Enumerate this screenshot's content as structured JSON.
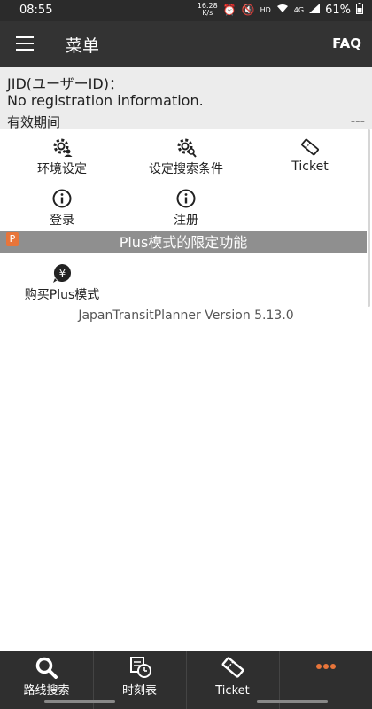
{
  "status_bar": {
    "time": "08:55",
    "speed_value": "16.28",
    "speed_unit": "K/s",
    "network": "4G",
    "hd": "HD",
    "battery": "61%"
  },
  "app_bar": {
    "title": "菜单",
    "faq_label": "FAQ"
  },
  "info": {
    "jid_label": "JID(ユーザーID)：",
    "registration": "No registration information.",
    "expiry_label": "有效期间",
    "expiry_value": "---"
  },
  "menu_grid": [
    {
      "label": "环境设定",
      "icon": "gear-person-icon"
    },
    {
      "label": "设定搜索条件",
      "icon": "gear-search-icon"
    },
    {
      "label": "Ticket",
      "icon": "ticket-icon"
    },
    {
      "label": "登录",
      "icon": "info-icon"
    },
    {
      "label": "注册",
      "icon": "info-icon"
    }
  ],
  "plus": {
    "badge": "P",
    "header": "Plus模式的限定功能",
    "buy_label": "购买Plus模式",
    "buy_icon": "yen-icon"
  },
  "version": "JapanTransitPlanner Version 5.13.0",
  "bottom_nav": [
    {
      "label": "路线搜索",
      "icon": "search-icon"
    },
    {
      "label": "时刻表",
      "icon": "timetable-icon"
    },
    {
      "label": "Ticket",
      "icon": "ticket-icon"
    },
    {
      "label": "",
      "icon": "more-icon"
    }
  ],
  "colors": {
    "app_bar": "#333333",
    "info_bg": "#ececec",
    "plus_header": "#8f8f8f",
    "accent": "#e8753a",
    "bottom_nav": "#2f2f2f"
  }
}
